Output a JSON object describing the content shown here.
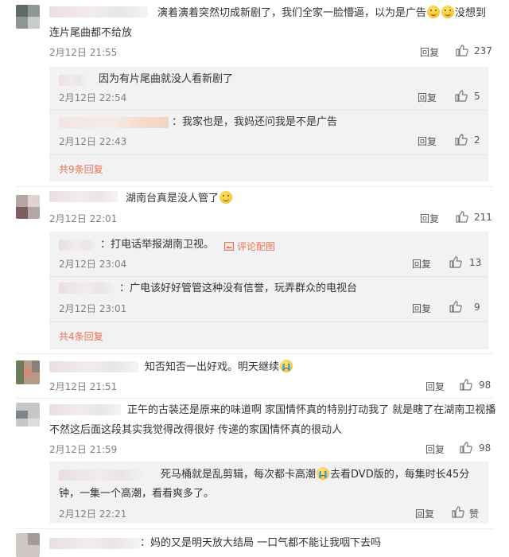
{
  "comments": [
    {
      "text_line1": "演着演着突然切成新剧了，我们全家一脸懵逼，以为是广告",
      "text_line1_suffix": "没想到",
      "text_line2": "连片尾曲都不给放",
      "time": "2月12日 21:55",
      "reply_label": "回复",
      "likes": "237",
      "replies": [
        {
          "text": "因为有片尾曲就没人看新剧了",
          "time": "2月12日 22:54",
          "reply_label": "回复",
          "likes": "5"
        },
        {
          "text": "：我家也是，我妈还问我是不是广告",
          "time": "2月12日 22:43",
          "reply_label": "回复",
          "likes": "2"
        }
      ],
      "more": "共9条回复"
    },
    {
      "text": "湖南台真是没人管了",
      "time": "2月12日 22:01",
      "reply_label": "回复",
      "likes": "211",
      "replies": [
        {
          "text": "：打电话举报湖南卫视。",
          "pic_label": "评论配图",
          "time": "2月12日 23:04",
          "reply_label": "回复",
          "likes": "13"
        },
        {
          "text": "：广电该好好管管这种没有信誉，玩弄群众的电视台",
          "time": "2月12日 23:01",
          "reply_label": "回复",
          "likes": "9"
        }
      ],
      "more": "共4条回复"
    },
    {
      "text": "知否知否一出好戏。明天继续",
      "time": "2月12日 21:51",
      "reply_label": "回复",
      "likes": "98"
    },
    {
      "text_line1": "正午的古装还是原来的味道啊 家国情怀真的特别打动我了 就是瞎了在湖南卫视播",
      "text_line2": "不然这后面这段其实我觉得改得很好 传递的家国情怀真的很动人",
      "time": "2月12日 21:59",
      "reply_label": "回复",
      "likes": "98",
      "replies": [
        {
          "text_line1": "死马桶就是乱剪辑，每次都卡高潮",
          "text_line1_suffix": "去看DVD版的，每集时长45分",
          "text_line2": "钟，一集一个高潮，看看爽多了。",
          "time": "2月12日 22:21",
          "reply_label": "回复",
          "likes": "赞"
        }
      ]
    },
    {
      "text": "：妈的又是明天放大结局 一口气都不能让我咽下去吗"
    }
  ],
  "colors": {
    "accent": "#eb7350",
    "reply_bg": "#f2f2f5",
    "time": "#808080"
  }
}
